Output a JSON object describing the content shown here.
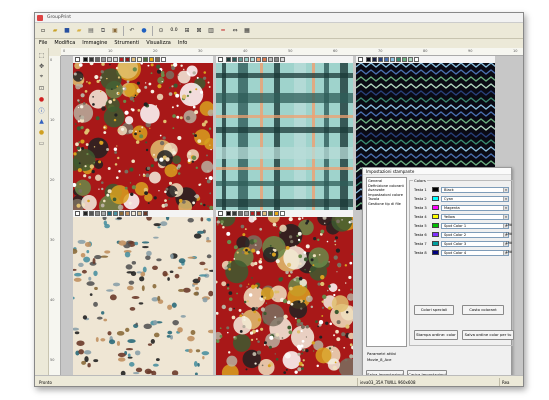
{
  "window": {
    "title": "GroupPrint"
  },
  "menu": {
    "items": [
      "File",
      "Modifica",
      "Immagine",
      "Strumenti",
      "Visualizza",
      "Info"
    ]
  },
  "toolbar": {
    "icons": [
      "new-icon",
      "open-icon",
      "save-icon",
      "folder-icon",
      "print-icon",
      "copy-icon",
      "paste-icon",
      "undo-icon",
      "globe-icon",
      "zoom-icon",
      "tool-a-icon",
      "tool-b-icon",
      "tool-c-icon",
      "tool-d-icon",
      "tool-e-icon",
      "grid-icon"
    ],
    "zoom_label": "0.0"
  },
  "rulers": {
    "top": [
      "0",
      "10",
      "20",
      "30",
      "40",
      "50",
      "60",
      "70",
      "80",
      "90",
      "10"
    ],
    "left": [
      "0",
      "10",
      "20",
      "30",
      "40",
      "50"
    ]
  },
  "dialog": {
    "title": "Impostazioni stampante",
    "sections": [
      "General",
      "Definizione colorant",
      "Avanzate",
      "Impostazioni colore",
      "Tavola",
      "Gestione tip di file"
    ],
    "colors_group_label": "Colors",
    "heads": [
      {
        "label": "Testa 1",
        "color": "#000000",
        "name": "Black"
      },
      {
        "label": "Testa 2",
        "color": "#00ffff",
        "name": "Cyan"
      },
      {
        "label": "Testa 3",
        "color": "#ff00ff",
        "name": "Magenta"
      },
      {
        "label": "Testa 4",
        "color": "#ffff00",
        "name": "Yellow"
      },
      {
        "label": "Testa 5",
        "color": "#00c000",
        "name": "Spot Color 1"
      },
      {
        "label": "Testa 6",
        "color": "#8030ff",
        "name": "Spot Color 2"
      },
      {
        "label": "Testa 7",
        "color": "#00a0a0",
        "name": "Spot Color 3"
      },
      {
        "label": "Testa 8",
        "color": "#000080",
        "name": "Spot Color 4"
      }
    ],
    "ulti_label": "Ulti",
    "btn_colori_speciali": "Colori speciali",
    "btn_costo_colori": "Costo colorant",
    "btn_stampa_ordine": "Stampa ordine: color",
    "btn_salva_ordine": "Salva ordine color per tu",
    "params_label": "Parametri attivi",
    "params_value": "Movie_8_Ace",
    "btn_salva_impostazioni": "Salva Impostazioni",
    "btn_carica_impostazioni": "Carica Impostazioni"
  },
  "status": {
    "left": "Pronto",
    "middle": "ieva03_35A  TWILL  960x608",
    "right": "Rea"
  },
  "palette_strips": {
    "floral": [
      "#111111",
      "#333333",
      "#666666",
      "#999999",
      "#cccccc",
      "#d8d8d8",
      "#b22222",
      "#8b1a1a",
      "#e0c080",
      "#f5f5dc",
      "#4a6b3a",
      "#e6a817",
      "#7a6a5a",
      "#ffffff"
    ],
    "plaid": [
      "#1b3a38",
      "#2f5d5a",
      "#6a9a95",
      "#9ecfc9",
      "#b8dcd8",
      "#f0a070",
      "#d87a50",
      "#c0c0c0",
      "#888888",
      "#dddddd"
    ],
    "zigzag": [
      "#0a0a14",
      "#1a2040",
      "#28407a",
      "#4a70b0",
      "#8ac0e0",
      "#3a8a70",
      "#6ab080",
      "#b0d8c0",
      "#ffffff"
    ],
    "paisley": [
      "#222222",
      "#555555",
      "#888888",
      "#aaaaaa",
      "#2a6a7a",
      "#4a90a0",
      "#8a6a3a",
      "#c09060",
      "#f0e8d8",
      "#cfb890",
      "#6a3a2a"
    ],
    "floral2": [
      "#111111",
      "#3a3a3a",
      "#707070",
      "#a0a0a0",
      "#b22222",
      "#8b1a1a",
      "#e0c080",
      "#4a6b3a",
      "#e6a817",
      "#ffffff"
    ]
  }
}
